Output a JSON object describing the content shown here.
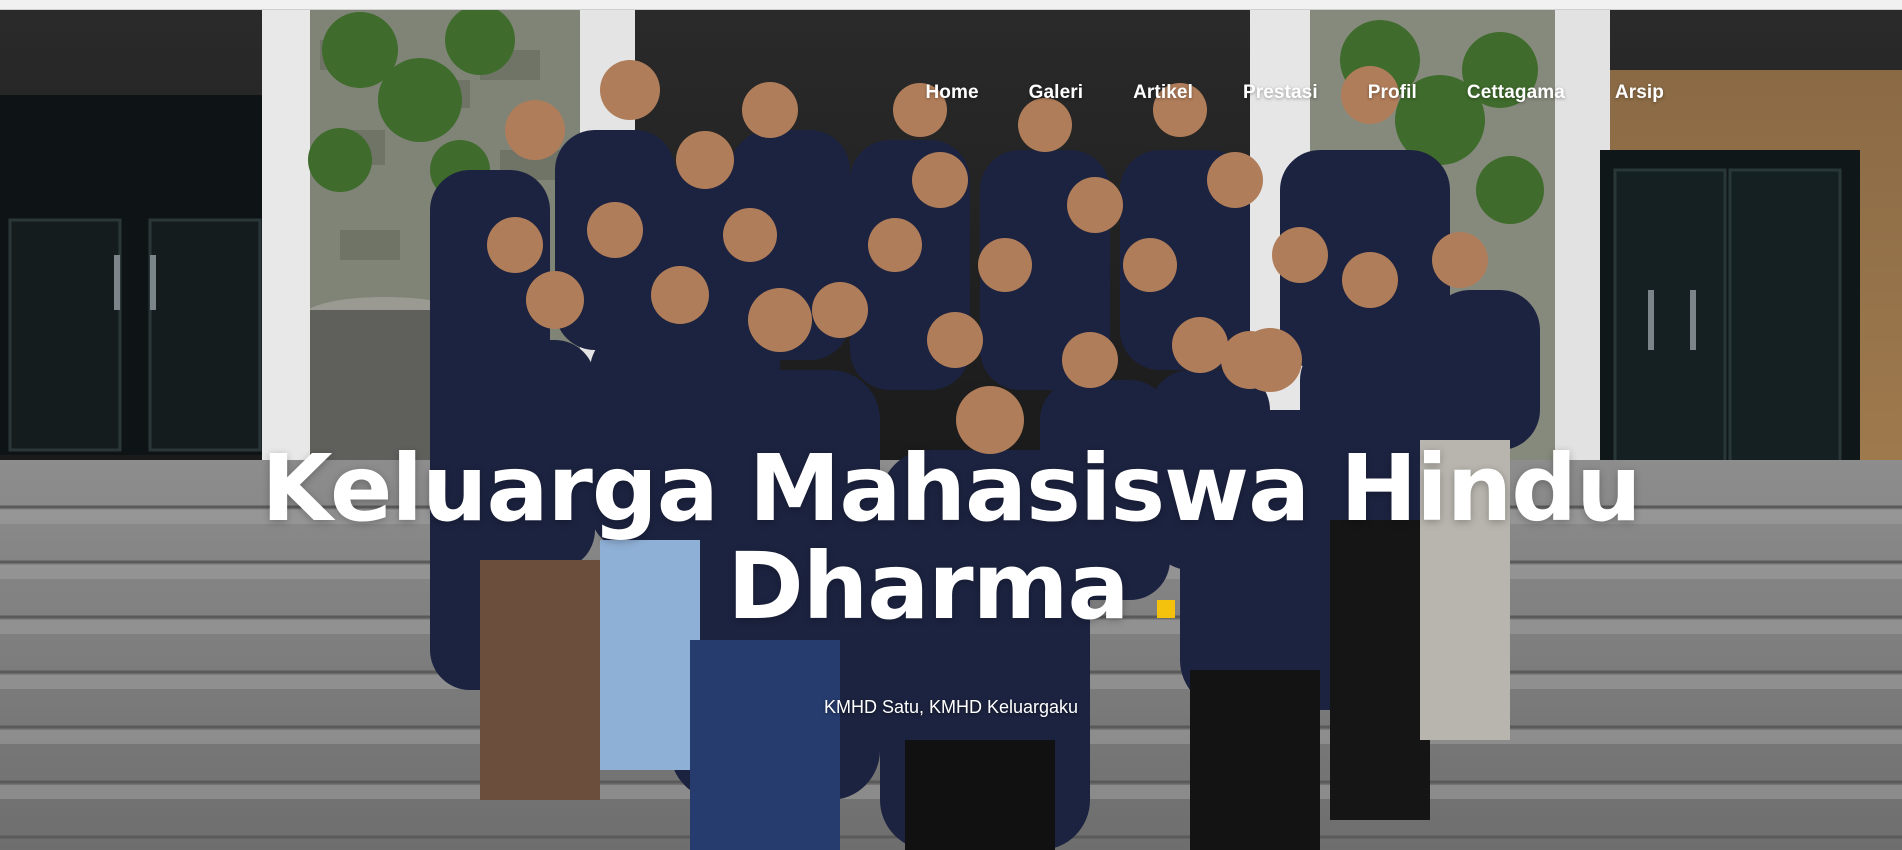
{
  "nav": {
    "items": [
      {
        "label": "Home"
      },
      {
        "label": "Galeri"
      },
      {
        "label": "Artikel"
      },
      {
        "label": "Prestasi"
      },
      {
        "label": "Profil"
      },
      {
        "label": "Cettagama"
      },
      {
        "label": "Arsip"
      }
    ]
  },
  "hero": {
    "title_line1": "Keluarga Mahasiswa Hindu",
    "title_line2": "Dharma",
    "subtitle": "KMHD Satu, KMHD Keluargaku",
    "accent_color": "#f4c20d"
  }
}
